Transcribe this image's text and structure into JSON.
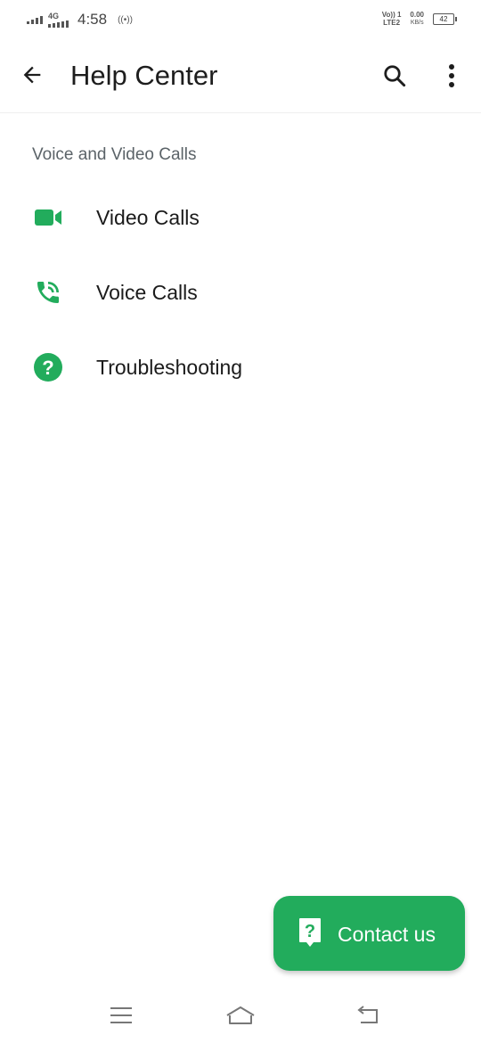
{
  "status_bar": {
    "network_type": "4G",
    "time": "4:58",
    "volte_top": "Vo)) 1",
    "volte_bottom": "LTE2",
    "speed_value": "0.00",
    "speed_unit": "KB/s",
    "battery": "42"
  },
  "app_bar": {
    "title": "Help Center",
    "back_icon": "arrow-left-icon",
    "search_icon": "search-icon",
    "menu_icon": "more-vertical-icon"
  },
  "section": {
    "title": "Voice and Video Calls"
  },
  "items": [
    {
      "label": "Video Calls",
      "icon": "video-camera-icon"
    },
    {
      "label": "Voice Calls",
      "icon": "phone-ringing-icon"
    },
    {
      "label": "Troubleshooting",
      "icon": "help-circle-icon"
    }
  ],
  "fab": {
    "label": "Contact us",
    "icon": "question-bubble-icon"
  },
  "colors": {
    "accent": "#22ac5c",
    "text_primary": "#1b1b1b",
    "text_secondary": "#5b6368"
  },
  "nav": {
    "menu_icon": "menu-lines-icon",
    "home_icon": "home-icon",
    "back_icon": "return-icon"
  }
}
